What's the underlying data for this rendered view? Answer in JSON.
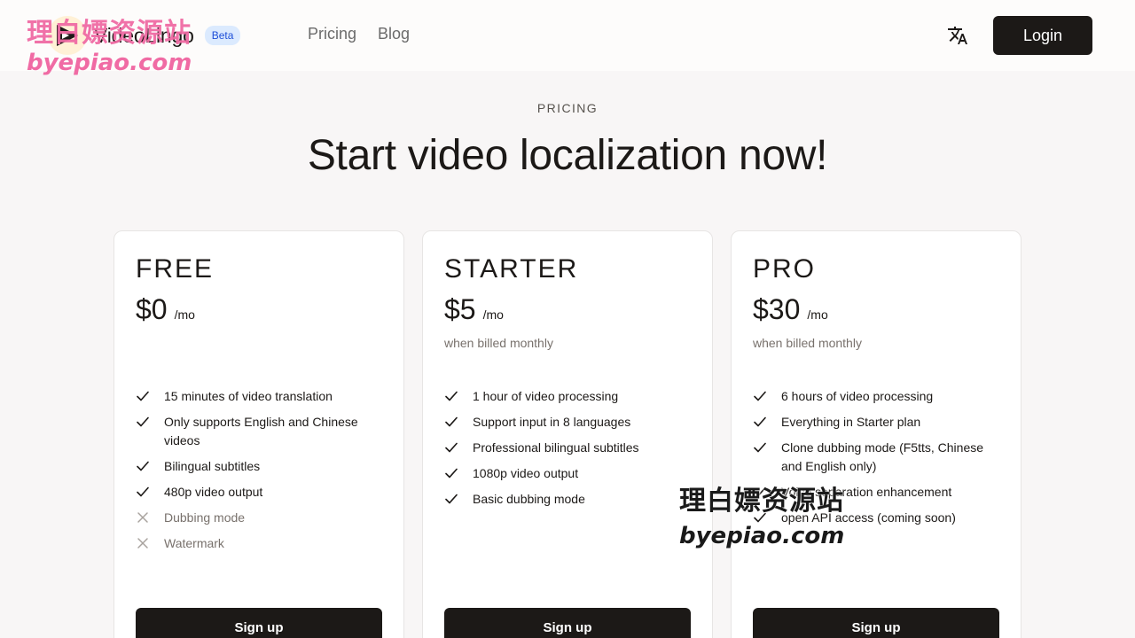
{
  "header": {
    "brand": "VideoLingo",
    "badge": "Beta",
    "nav": [
      "Pricing",
      "Blog"
    ],
    "login_label": "Login",
    "language_icon": "translate-icon"
  },
  "hero": {
    "eyebrow": "PRICING",
    "title": "Start video localization now!"
  },
  "plans": [
    {
      "name": "FREE",
      "price": "$0",
      "period": "/mo",
      "billing": "",
      "features": [
        {
          "text": "15 minutes of video translation",
          "included": true
        },
        {
          "text": "Only supports English and Chinese videos",
          "included": true
        },
        {
          "text": "Bilingual subtitles",
          "included": true
        },
        {
          "text": "480p video output",
          "included": true
        },
        {
          "text": "Dubbing mode",
          "included": false
        },
        {
          "text": "Watermark",
          "included": false
        }
      ],
      "cta": "Sign up"
    },
    {
      "name": "STARTER",
      "price": "$5",
      "period": "/mo",
      "billing": "when billed monthly",
      "features": [
        {
          "text": "1 hour of video processing",
          "included": true
        },
        {
          "text": "Support input in 8 languages",
          "included": true
        },
        {
          "text": "Professional bilingual subtitles",
          "included": true
        },
        {
          "text": "1080p video output",
          "included": true
        },
        {
          "text": "Basic dubbing mode",
          "included": true
        }
      ],
      "cta": "Sign up"
    },
    {
      "name": "PRO",
      "price": "$30",
      "period": "/mo",
      "billing": "when billed monthly",
      "features": [
        {
          "text": "6 hours of video processing",
          "included": true
        },
        {
          "text": "Everything in Starter plan",
          "included": true
        },
        {
          "text": "Clone dubbing mode (F5tts, Chinese and English only)",
          "included": true
        },
        {
          "text": "Voice separation enhancement",
          "included": true
        },
        {
          "text": "open API access (coming soon)",
          "included": true
        }
      ],
      "cta": "Sign up"
    }
  ],
  "watermark": {
    "cn": "理白嫖资源站",
    "en": "byepiao.com",
    "color_top": "#f06ba4",
    "color_mid": "#1a1a1a"
  },
  "colors": {
    "primary": "#1c1917",
    "background": "#f8f6f6",
    "muted": "#78716c",
    "badge_bg": "#dbeafe",
    "badge_text": "#1d4ed8"
  }
}
